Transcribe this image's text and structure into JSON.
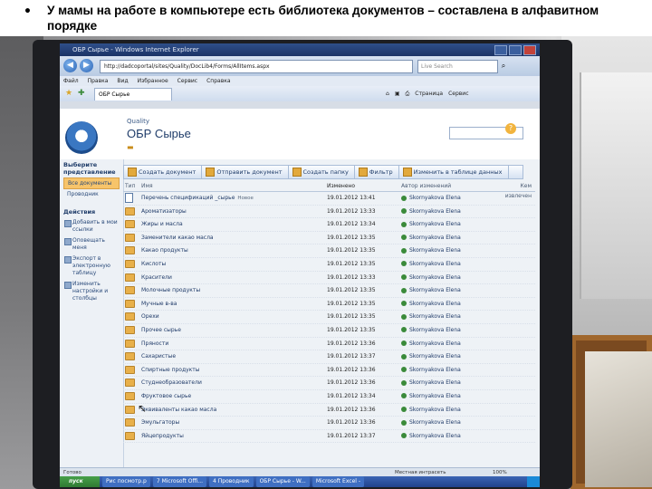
{
  "caption": {
    "bullet": "•",
    "text": "У мамы на работе в компьютере есть библиотека документов – составлена в алфавитном порядке"
  },
  "browser": {
    "window_title": "ОБР Сырье - Windows Internet Explorer",
    "address": "http://dadcoportal/sites/Quality/DocLib4/Forms/AllItems.aspx",
    "search_placeholder": "Live Search",
    "menu": [
      "Файл",
      "Правка",
      "Вид",
      "Избранное",
      "Сервис",
      "Справка"
    ],
    "tab_label": "ОБР Сырье",
    "commands": [
      "Страница",
      "Сервис"
    ]
  },
  "site": {
    "parent_label": "Quality",
    "title": "ОБР Сырье"
  },
  "quick_launch": {
    "view_heading": "Выберите представление",
    "views": [
      "Все документы",
      "Проводник"
    ],
    "actions_heading": "Действия",
    "actions": [
      "Добавить в мои ссылки",
      "Оповещать меня",
      "Экспорт в электронную таблицу",
      "Изменить настройки и столбцы"
    ]
  },
  "toolbar": {
    "buttons": [
      "Создать документ",
      "Отправить документ",
      "Создать папку",
      "Фильтр",
      "Изменить в таблице данных"
    ]
  },
  "list": {
    "columns": {
      "type": "Тип",
      "name": "Имя",
      "modified": "Изменено",
      "author": "Автор изменений",
      "extra": "Кем извлечен"
    },
    "rows": [
      {
        "name": "Перечень спецификаций _сырье",
        "modified": "19.01.2012 13:41",
        "author": "Skornyakova Elena",
        "is_doc": true,
        "badge": "Новое"
      },
      {
        "name": "Ароматизаторы",
        "modified": "19.01.2012 13:33",
        "author": "Skornyakova Elena"
      },
      {
        "name": "Жиры и масла",
        "modified": "19.01.2012 13:34",
        "author": "Skornyakova Elena"
      },
      {
        "name": "Заменители какао масла",
        "modified": "19.01.2012 13:35",
        "author": "Skornyakova Elena"
      },
      {
        "name": "Какао продукты",
        "modified": "19.01.2012 13:35",
        "author": "Skornyakova Elena"
      },
      {
        "name": "Кислоты",
        "modified": "19.01.2012 13:35",
        "author": "Skornyakova Elena"
      },
      {
        "name": "Красители",
        "modified": "19.01.2012 13:33",
        "author": "Skornyakova Elena"
      },
      {
        "name": "Молочные продукты",
        "modified": "19.01.2012 13:35",
        "author": "Skornyakova Elena"
      },
      {
        "name": "Мучные в-ва",
        "modified": "19.01.2012 13:35",
        "author": "Skornyakova Elena"
      },
      {
        "name": "Орехи",
        "modified": "19.01.2012 13:35",
        "author": "Skornyakova Elena"
      },
      {
        "name": "Прочее сырье",
        "modified": "19.01.2012 13:35",
        "author": "Skornyakova Elena"
      },
      {
        "name": "Пряности",
        "modified": "19.01.2012 13:36",
        "author": "Skornyakova Elena"
      },
      {
        "name": "Сахаристые",
        "modified": "19.01.2012 13:37",
        "author": "Skornyakova Elena"
      },
      {
        "name": "Спиртные продукты",
        "modified": "19.01.2012 13:36",
        "author": "Skornyakova Elena"
      },
      {
        "name": "Студнеобразователи",
        "modified": "19.01.2012 13:36",
        "author": "Skornyakova Elena"
      },
      {
        "name": "Фруктовое сырье",
        "modified": "19.01.2012 13:34",
        "author": "Skornyakova Elena"
      },
      {
        "name": "Эквиваленты какао масла",
        "modified": "19.01.2012 13:36",
        "author": "Skornyakova Elena"
      },
      {
        "name": "Эмульгаторы",
        "modified": "19.01.2012 13:36",
        "author": "Skornyakova Elena"
      },
      {
        "name": "Яйцепродукты",
        "modified": "19.01.2012 13:37",
        "author": "Skornyakova Elena"
      }
    ]
  },
  "status": {
    "left": "Готово",
    "zone": "Местная интрасеть",
    "zoom": "100%"
  },
  "taskbar": {
    "start": "пуск",
    "items": [
      "Рис посмотр.р",
      "7 Microsoft Offi...",
      "4 Проводник",
      "ОБР Сырье - W...",
      "Microsoft Excel -"
    ],
    "tray_time": ""
  },
  "colors": {
    "accent": "#203d6a",
    "selected_view": "#f7c46a",
    "taskbar": "#20438c"
  }
}
